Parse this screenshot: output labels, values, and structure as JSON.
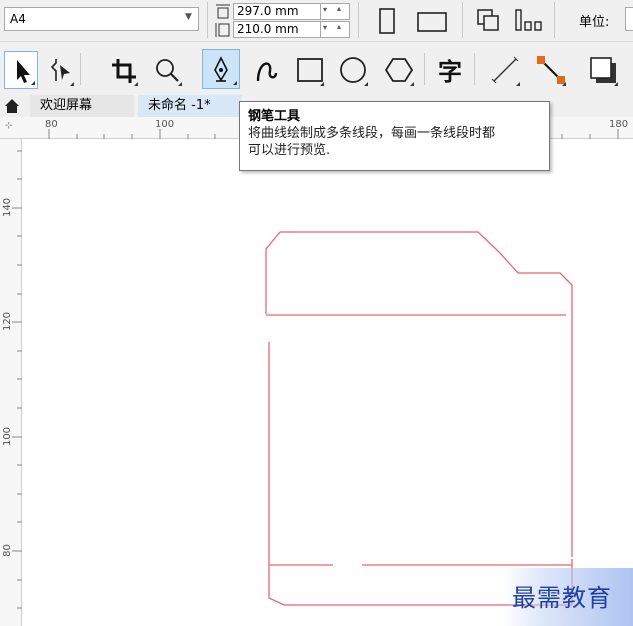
{
  "propbar": {
    "page_size": "A4",
    "height_value": "297.0 mm",
    "width_value": "210.0 mm",
    "units_label": "单位:"
  },
  "tabs": [
    {
      "label": "欢迎屏幕"
    },
    {
      "label": "未命名 -1*"
    }
  ],
  "ruler": {
    "h_ticks": [
      "80",
      "100",
      "180"
    ],
    "v_ticks": [
      "140",
      "120",
      "100",
      "80"
    ]
  },
  "tooltip": {
    "title": "钢笔工具",
    "line1": "将曲线绘制成多条线段，每画一条线段时都",
    "line2": "可以进行预览."
  },
  "watermark": "最需教育",
  "colors": {
    "outline": "#e8676f",
    "watermark_text": "#1f3fa6",
    "active_tool": "#cce4f7"
  }
}
